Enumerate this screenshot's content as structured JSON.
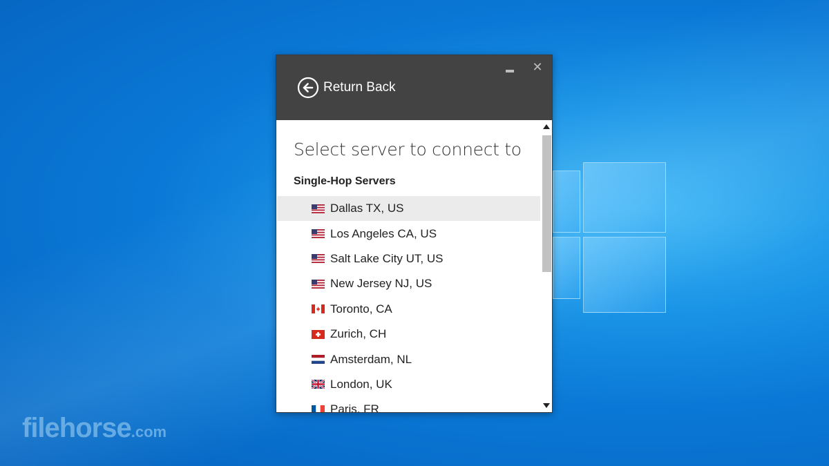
{
  "watermark": {
    "brand": "filehorse",
    "suffix": ".com"
  },
  "window": {
    "minimize_icon": "minimize-icon",
    "close_symbol": "✕",
    "return_label": "Return Back",
    "heading": "Select server to connect to",
    "section_title": "Single-Hop Servers",
    "servers": [
      {
        "label": "Dallas TX, US",
        "flag": "us",
        "selected": true
      },
      {
        "label": "Los Angeles CA, US",
        "flag": "us"
      },
      {
        "label": "Salt Lake City UT, US",
        "flag": "us"
      },
      {
        "label": "New Jersey NJ, US",
        "flag": "us"
      },
      {
        "label": "Toronto, CA",
        "flag": "ca"
      },
      {
        "label": "Zurich, CH",
        "flag": "ch"
      },
      {
        "label": "Amsterdam, NL",
        "flag": "nl"
      },
      {
        "label": "London, UK",
        "flag": "uk"
      },
      {
        "label": "Paris, FR",
        "flag": "fr"
      }
    ]
  },
  "colors": {
    "titlebar": "#434343",
    "selected_row": "#ebebeb",
    "scroll_thumb": "#c2c2c2"
  }
}
